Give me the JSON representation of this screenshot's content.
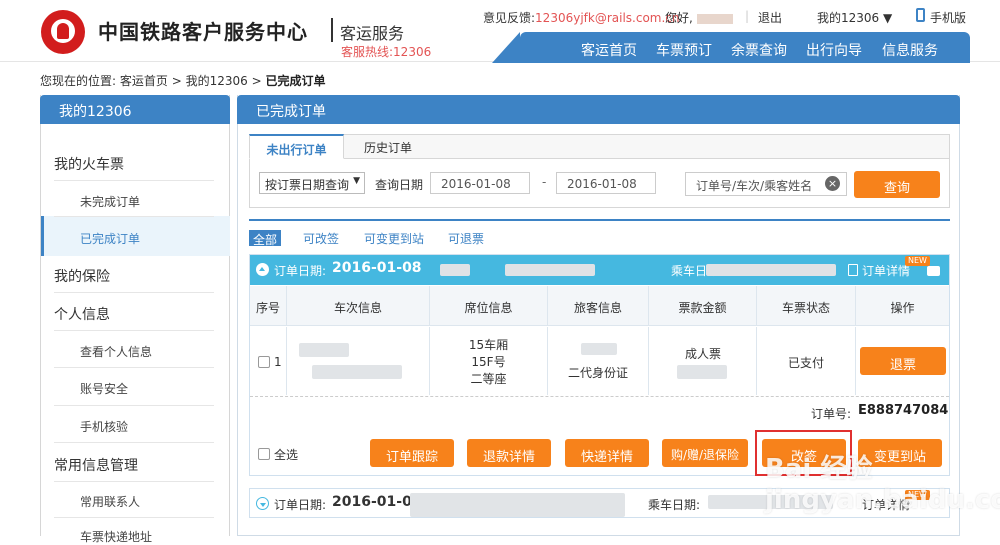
{
  "header": {
    "brand": "中国铁路客户服务中心",
    "sub_brand": "客运服务",
    "hotline": "客服热线:12306",
    "feedback_label": "意见反馈:",
    "feedback_email": "12306yjfk@rails.com.cn",
    "greeting": "您好,",
    "logout": "退出",
    "my12306": "我的12306 ▼",
    "mobile": "手机版",
    "nav": [
      "客运首页",
      "车票预订",
      "余票查询",
      "出行向导",
      "信息服务"
    ]
  },
  "breadcrumb": {
    "prefix": "您现在的位置:",
    "home": "客运首页",
    "sep1": ">",
    "my": "我的12306",
    "sep2": ">",
    "current": "已完成订单"
  },
  "sidebar": {
    "title": "我的12306",
    "sections": [
      {
        "label": "我的火车票",
        "items": [
          "未完成订单",
          "已完成订单"
        ]
      },
      {
        "label": "我的保险",
        "items": []
      },
      {
        "label": "个人信息",
        "items": [
          "查看个人信息",
          "账号安全",
          "手机核验"
        ]
      },
      {
        "label": "常用信息管理",
        "items": [
          "常用联系人",
          "车票快递地址"
        ]
      }
    ]
  },
  "main": {
    "title": "已完成订单",
    "tabs": [
      "未出行订单",
      "历史订单"
    ],
    "query": {
      "type_select": "按订票日期查询",
      "date_label": "查询日期",
      "start_date": "2016-01-08",
      "end_date": "2016-01-08",
      "dash": "-",
      "search_placeholder": "订单号/车次/乘客姓名",
      "query_button": "查询"
    },
    "filters": [
      "全部",
      "可改签",
      "可变更到站",
      "可退票"
    ],
    "order": {
      "order_date_label": "订单日期:",
      "order_date": "2016-01-08",
      "ride_date_label": "乘车日期:",
      "detail_link": "订单详情",
      "new_badge": "NEW",
      "columns": [
        "序号",
        "车次信息",
        "席位信息",
        "旅客信息",
        "票款金额",
        "车票状态",
        "操作"
      ],
      "row": {
        "index": "1",
        "seat": [
          "15车厢",
          "15F号",
          "二等座"
        ],
        "passenger_id": "二代身份证",
        "fare_type": "成人票",
        "status": "已支付",
        "action": "退票"
      },
      "order_no_label": "订单号:",
      "order_no": "E888747084",
      "select_all": "全选",
      "buttons": [
        "订单跟踪",
        "退款详情",
        "快递详情",
        "购/赠/退保险",
        "改签",
        "变更到站"
      ]
    },
    "order2": {
      "order_date_label": "订单日期:",
      "order_date_partial": "2016-01-0",
      "ride_date_partial": "乘车日期:",
      "detail_link": "订单详情",
      "new_badge": "NEW"
    }
  },
  "watermark": "Bai 经验 jingyan.baidu.com",
  "colors": {
    "primary": "#3d83c5",
    "accent": "#f7821b",
    "header_bar": "#45b8e0",
    "logo": "#d21d1d"
  }
}
